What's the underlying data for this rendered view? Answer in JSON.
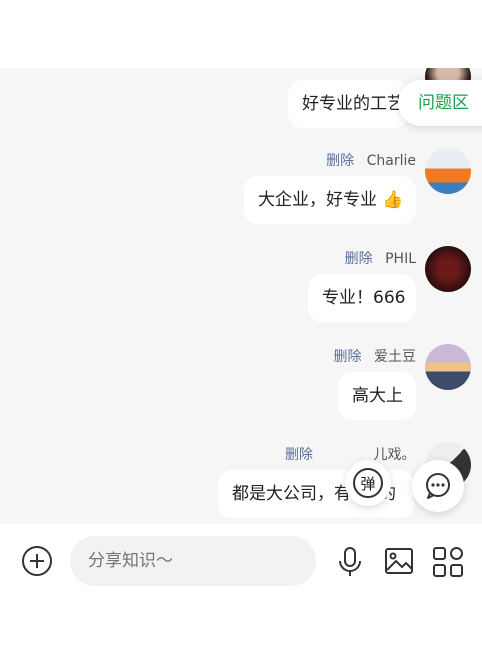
{
  "topic_pill": "问题区",
  "messages": [
    {
      "text": "好专业的工艺",
      "author": "",
      "delete_label": ""
    },
    {
      "text": "大企业，好专业",
      "emoji": "👍",
      "author": "Charlie",
      "delete_label": "删除"
    },
    {
      "text": "专业！666",
      "author": "PHIL",
      "delete_label": "删除"
    },
    {
      "text": "高大上",
      "author": "爱土豆",
      "delete_label": "删除"
    },
    {
      "text": "都是大公司，有",
      "text_tail": "的",
      "author": "儿戏。",
      "delete_label": "删除"
    }
  ],
  "danmu_label": "弹",
  "input": {
    "placeholder": "分享知识～"
  }
}
